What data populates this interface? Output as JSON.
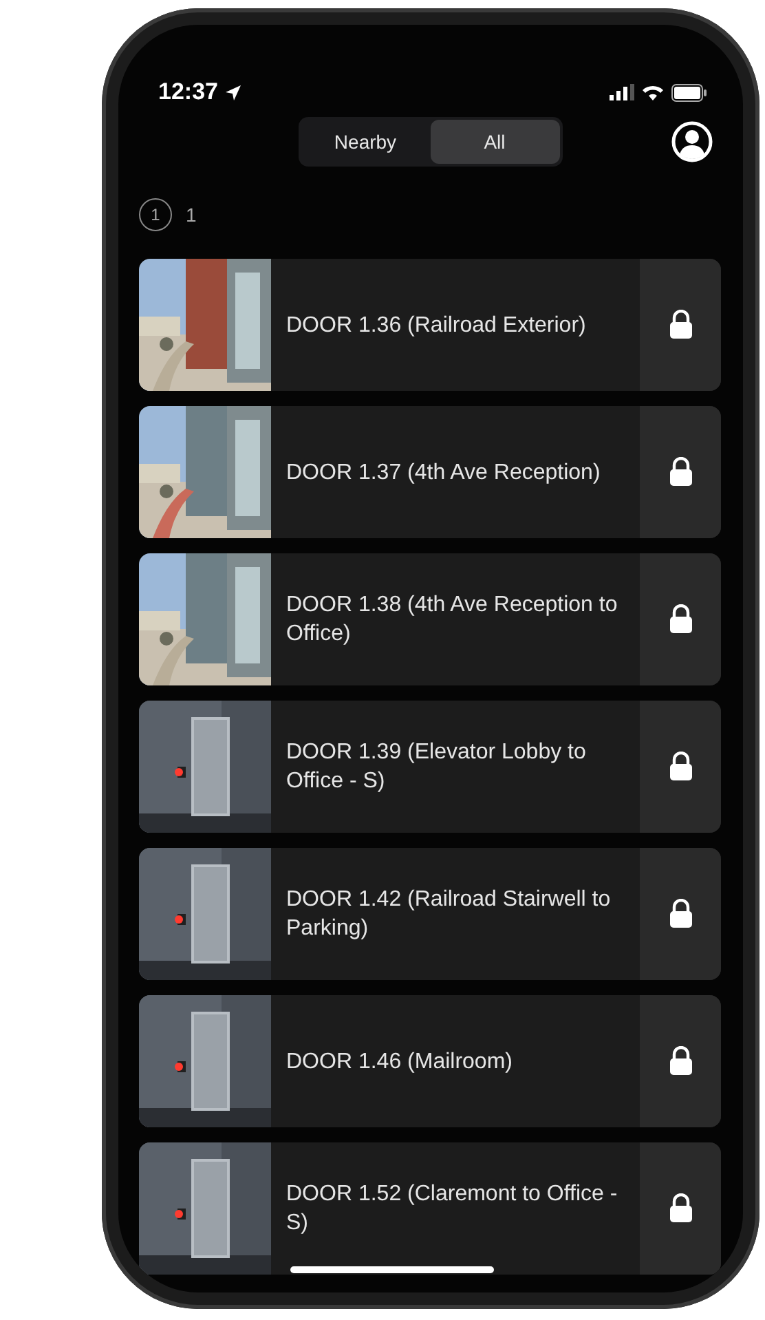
{
  "status_bar": {
    "time": "12:37"
  },
  "segments": [
    {
      "label": "Nearby",
      "selected": false
    },
    {
      "label": "All",
      "selected": true
    }
  ],
  "counter": {
    "badge": "1",
    "count": "1"
  },
  "doors": [
    {
      "name": "DOOR 1.36 (Railroad Exterior)",
      "locked": true
    },
    {
      "name": "DOOR 1.37 (4th Ave Reception)",
      "locked": true
    },
    {
      "name": "DOOR 1.38 (4th Ave Reception to Office)",
      "locked": true
    },
    {
      "name": "DOOR 1.39 (Elevator Lobby to Office - S)",
      "locked": true
    },
    {
      "name": "DOOR 1.42 (Railroad Stairwell to Parking)",
      "locked": true
    },
    {
      "name": "DOOR 1.46 (Mailroom)",
      "locked": true
    },
    {
      "name": "DOOR 1.52 (Claremont to Office - S)",
      "locked": true
    }
  ]
}
